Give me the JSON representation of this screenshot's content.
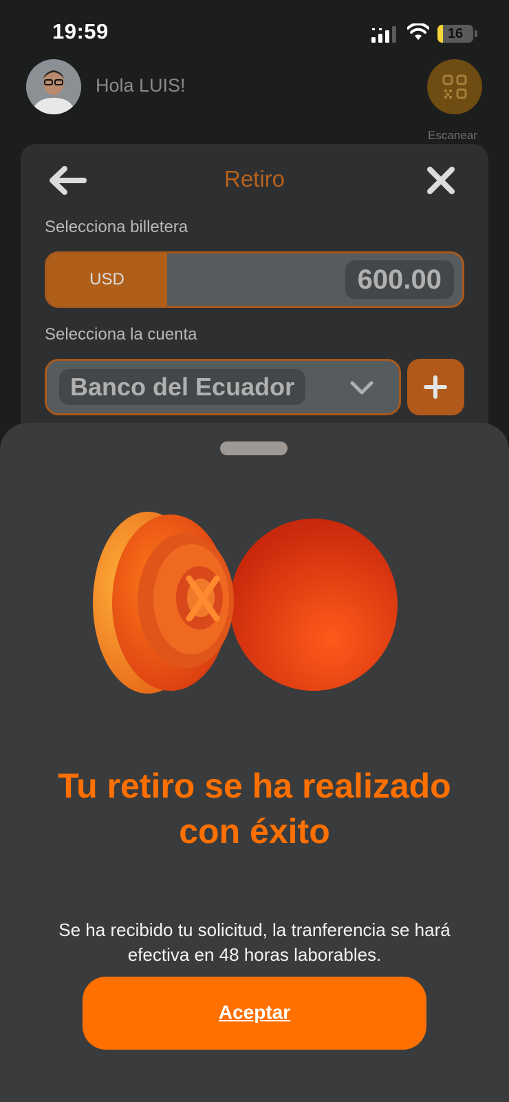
{
  "status_bar": {
    "time": "19:59",
    "battery": "16",
    "battery_level": 0.16
  },
  "header": {
    "greeting": "Hola LUIS!",
    "scan_label": "Escanear"
  },
  "withdraw_card": {
    "title": "Retiro",
    "wallet_label": "Selecciona billetera",
    "wallet_currency": "USD",
    "wallet_amount": "600.00",
    "account_label": "Selecciona la cuenta",
    "account_name": "Banco del Ecuador"
  },
  "success_sheet": {
    "title_line1": "Tu retiro se ha realizado",
    "title_line2": "con éxito",
    "message_line1": "Se ha recibido tu solicitud, la tranferencia se hará",
    "message_line2": "efectiva en 48 horas laborables.",
    "accept_label": "Aceptar"
  },
  "colors": {
    "accent": "#ff7000",
    "sheet_bg": "#3a3b3d",
    "background": "#1c1d1d"
  },
  "icons": [
    "signal-icon",
    "wifi-icon",
    "battery-icon",
    "qr-scan-icon",
    "back-arrow-icon",
    "close-icon",
    "chevron-down-icon",
    "plus-icon",
    "vault-illustration"
  ]
}
